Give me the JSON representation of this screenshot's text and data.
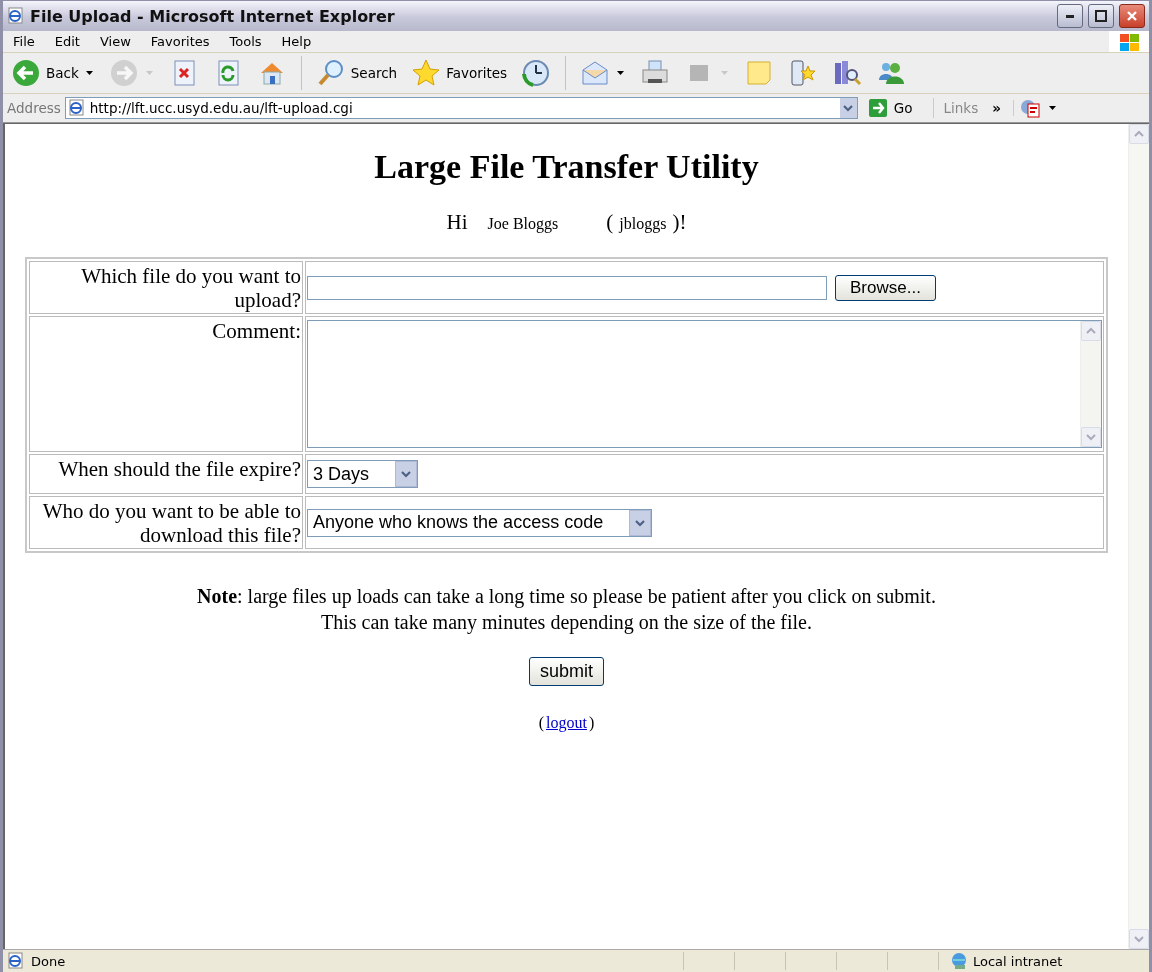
{
  "window": {
    "title": "File Upload - Microsoft Internet Explorer"
  },
  "menu": [
    "File",
    "Edit",
    "View",
    "Favorites",
    "Tools",
    "Help"
  ],
  "toolbar": [
    {
      "kind": "back",
      "label": "Back",
      "dropdown": true
    },
    {
      "kind": "forward",
      "dropdown": true,
      "disabled": true
    },
    {
      "kind": "stop"
    },
    {
      "kind": "refresh"
    },
    {
      "kind": "home"
    },
    {
      "kind": "sep"
    },
    {
      "kind": "search",
      "label": "Search"
    },
    {
      "kind": "favorites",
      "label": "Favorites"
    },
    {
      "kind": "history"
    },
    {
      "kind": "sep"
    },
    {
      "kind": "mail",
      "dropdown": true
    },
    {
      "kind": "print"
    },
    {
      "kind": "edit",
      "dropdown": true,
      "disabled": true
    },
    {
      "kind": "note"
    },
    {
      "kind": "phone"
    },
    {
      "kind": "research"
    },
    {
      "kind": "messenger"
    }
  ],
  "address": {
    "label": "Address",
    "value": "http://lft.ucc.usyd.edu.au/lft-upload.cgi",
    "go": "Go",
    "links": "Links",
    "chevron": "»"
  },
  "page": {
    "heading": "Large File Transfer Utility",
    "greeting": [
      "Hi",
      "Joe Bloggs",
      "(",
      "jbloggs",
      ")!"
    ],
    "form": [
      {
        "kind": "file",
        "label": "Which file do you want to upload?",
        "button": "Browse..."
      },
      {
        "kind": "textarea",
        "label": "Comment:"
      },
      {
        "kind": "select",
        "label": "When should the file expire?",
        "value": "3 Days"
      },
      {
        "kind": "select",
        "label": "Who do you want to be able to download this file?",
        "value": "Anyone who knows the access code"
      }
    ],
    "note": [
      "**Note**: large files up loads can take a long time so please be patient after you click on submit.",
      "This can take many minutes depending on the size of the file."
    ],
    "submit": "submit",
    "logout": {
      "open": "(",
      "link": "logout",
      "close": ")"
    }
  },
  "status_bar": {
    "text": "Done",
    "zone": "Local intranet"
  }
}
